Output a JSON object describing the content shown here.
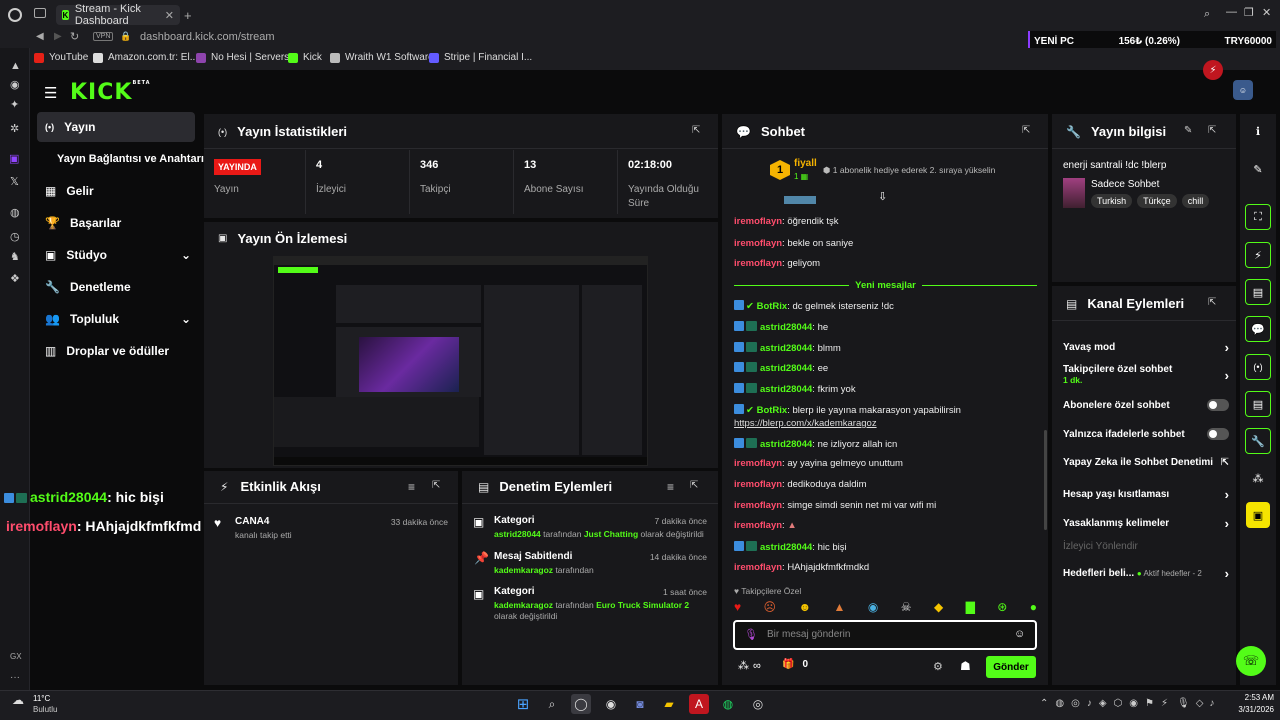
{
  "browser": {
    "tab_title": "Stream - Kick Dashboard",
    "url_host": "dashboard.kick.com",
    "url_path": "/stream",
    "vpn": "VPN",
    "ticker": {
      "name": "YENİ PC",
      "value": "156₺ (0.26%)",
      "code": "TRY60000"
    },
    "bookmarks": [
      "YouTube",
      "Amazon.com.tr: El...",
      "No Hesi | Servers",
      "Kick",
      "Wraith W1 Software",
      "Stripe | Financial I..."
    ]
  },
  "logo": {
    "text": "KICK",
    "beta": "BETA"
  },
  "sidebar": {
    "items": [
      "Yayın",
      "Yayın Bağlantısı ve Anahtarı",
      "Gelir",
      "Başarılar",
      "Stüdyo",
      "Denetleme",
      "Topluluk",
      "Droplar ve ödüller"
    ]
  },
  "stats": {
    "title": "Yayın İstatistikleri",
    "live_badge": "YAYINDA",
    "items": [
      {
        "value": "",
        "label": "Yayın"
      },
      {
        "value": "4",
        "label": "İzleyici"
      },
      {
        "value": "346",
        "label": "Takipçi"
      },
      {
        "value": "13",
        "label": "Abone Sayısı"
      },
      {
        "value": "02:18:00",
        "label": "Yayında Olduğu Süre"
      }
    ]
  },
  "preview": {
    "title": "Yayın Ön İzlemesi"
  },
  "overlay_chat": [
    {
      "user": "astrid28044",
      "text": ": hic bişi"
    },
    {
      "user": "iremoflayn",
      "text": ": HAhjajdkfmfkfmdkd"
    }
  ],
  "activity": {
    "title": "Etkinlik Akışı",
    "events": [
      {
        "user": "CANA4",
        "desc": "kanalı takip etti",
        "time": "33 dakika önce"
      }
    ]
  },
  "moderation": {
    "title": "Denetim Eylemleri",
    "items": [
      {
        "title": "Kategori",
        "time": "7 dakika önce",
        "l1_user": "astrid28044",
        "l1_mid": "tarafından",
        "l1_target": "Just Chatting",
        "l1_tail": "olarak değiştirildi",
        "l2": ""
      },
      {
        "title": "Mesaj Sabitlendi",
        "time": "14 dakika önce",
        "l1_user": "kademkaragoz",
        "l1_mid": "tarafından",
        "l1_target": "",
        "l1_tail": "",
        "l2": ""
      },
      {
        "title": "Kategori",
        "time": "1 saat önce",
        "l1_user": "kademkaragoz",
        "l1_mid": "tarafından",
        "l1_target": "Euro Truck Simulator 2",
        "l1_tail": "",
        "l2": "olarak değiştirildi"
      }
    ]
  },
  "chat": {
    "title": "Sohbet",
    "pinned": {
      "user": "fiyall",
      "rank": "1",
      "notice": "1 abonelik hediye ederek 2. sıraya yükselin"
    },
    "divider": "Yeni mesajlar",
    "messages": [
      {
        "user": "iremoflayn",
        "text": ": öğrendik tşk",
        "type": "red"
      },
      {
        "user": "iremoflayn",
        "text": ": bekle on saniye",
        "type": "red"
      },
      {
        "user": "iremoflayn",
        "text": ": geliyom",
        "type": "red"
      },
      {
        "user": "BotRix",
        "text": ": dc gelmek isterseniz !dc",
        "type": "bot"
      },
      {
        "user": "astrid28044",
        "text": ": he",
        "type": "grn"
      },
      {
        "user": "astrid28044",
        "text": ": blmm",
        "type": "grn"
      },
      {
        "user": "astrid28044",
        "text": ": ee",
        "type": "grn"
      },
      {
        "user": "astrid28044",
        "text": ": fkrim yok",
        "type": "grn"
      },
      {
        "user": "BotRix",
        "text": ": blerp ile yayına makarasyon yapabilirsin",
        "type": "bot"
      },
      {
        "user": "",
        "text": "https://blerp.com/x/kademkaragoz",
        "type": "link"
      },
      {
        "user": "astrid28044",
        "text": ": ne izliyorz allah icn",
        "type": "grn"
      },
      {
        "user": "iremoflayn",
        "text": ": ay yayina gelmeyo unuttum",
        "type": "red"
      },
      {
        "user": "iremoflayn",
        "text": ": dedikoduya daldim",
        "type": "red"
      },
      {
        "user": "iremoflayn",
        "text": ": simge simdi senin net mi var wifi mi",
        "type": "red"
      },
      {
        "user": "iremoflayn",
        "text": ":",
        "type": "red"
      },
      {
        "user": "astrid28044",
        "text": ": hic bişi",
        "type": "grn"
      },
      {
        "user": "iremoflayn",
        "text": ": HAhjajdkfmfkfmdkd",
        "type": "red"
      }
    ],
    "follower_only": "Takipçilere Özel",
    "input_placeholder": "Bir mesaj gönderin",
    "points": "∞",
    "gift_count": "0",
    "send": "Gönder"
  },
  "stream_info": {
    "title": "Yayın bilgisi",
    "stream_title": "enerji santrali !dc !blerp",
    "category": "Sadece Sohbet",
    "tags": [
      "Turkish",
      "Türkçe",
      "chill"
    ]
  },
  "channel_actions": {
    "title": "Kanal Eylemleri",
    "items": [
      "Yavaş mod",
      "Takipçilere özel sohbet",
      "Abonelere özel sohbet",
      "Yalnızca ifadelerle sohbet",
      "Yapay Zeka ile Sohbet Denetimi",
      "Hesap yaşı kısıtlaması",
      "Yasaklanmış kelimeler",
      "İzleyici Yönlendir",
      "Hedefleri beli..."
    ],
    "follower_sub": "1 dk.",
    "goals_status": "Aktif hedefler - 2"
  },
  "taskbar": {
    "weather_temp": "11°C",
    "weather_desc": "Bulutlu",
    "time": "2:53 AM",
    "date": "3/31/2026",
    "opera_gx": "GX"
  },
  "colors": {
    "kick_green": "#53fc18",
    "live_red": "#e91916",
    "panel": "#18181b",
    "bg": "#0b0b0c"
  }
}
